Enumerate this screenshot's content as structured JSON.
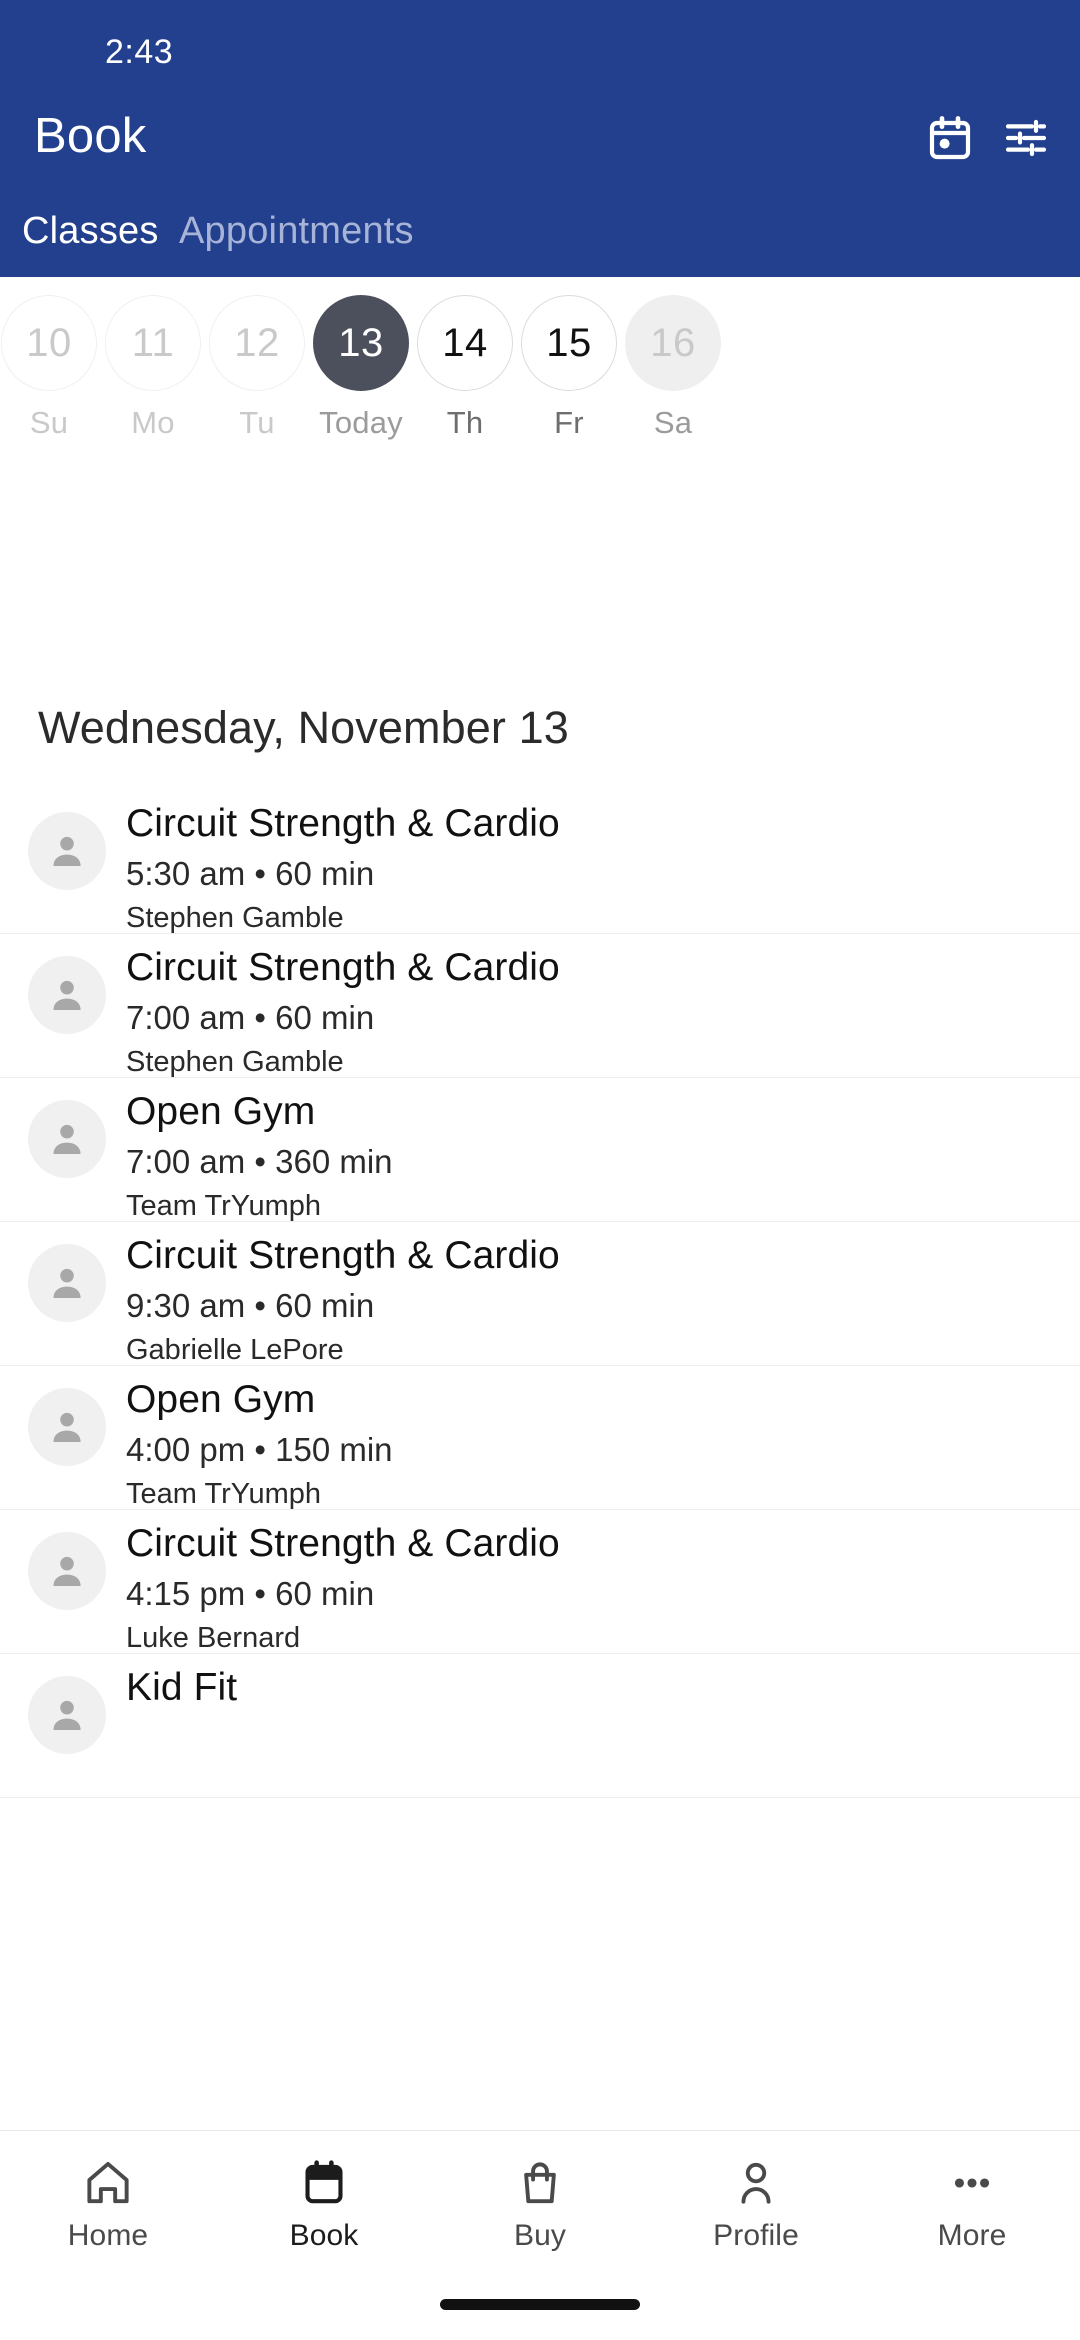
{
  "status_bar": {
    "clock": "2:43"
  },
  "header": {
    "title": "Book",
    "actions": [
      {
        "name": "calendar-picker-icon",
        "label": "Calendar"
      },
      {
        "name": "filter-icon",
        "label": "Filters"
      }
    ],
    "tabs": [
      {
        "label": "Classes",
        "active": true
      },
      {
        "label": "Appointments",
        "active": false
      }
    ],
    "background": "#23408e",
    "active_tab_color": "#ffffff",
    "inactive_tab_color": "#a7b4d8"
  },
  "date_strip": {
    "days": [
      {
        "day": "10",
        "weekday": "Su",
        "state": "past"
      },
      {
        "day": "11",
        "weekday": "Mo",
        "state": "past"
      },
      {
        "day": "12",
        "weekday": "Tu",
        "state": "past"
      },
      {
        "day": "13",
        "weekday": "Today",
        "state": "today"
      },
      {
        "day": "14",
        "weekday": "Th",
        "state": "future"
      },
      {
        "day": "15",
        "weekday": "Fr",
        "state": "future"
      },
      {
        "day": "16",
        "weekday": "Sa",
        "state": "edge"
      }
    ],
    "selected_color": "#4c505c"
  },
  "day_heading": "Wednesday, November 13",
  "classes": [
    {
      "title": "Circuit Strength & Cardio",
      "meta": "5:30 am • 60 min",
      "staff": "Stephen Gamble"
    },
    {
      "title": "Circuit Strength & Cardio",
      "meta": "7:00 am • 60 min",
      "staff": "Stephen Gamble"
    },
    {
      "title": "Open Gym",
      "meta": "7:00 am • 360 min",
      "staff": "Team TrYumph"
    },
    {
      "title": "Circuit Strength & Cardio",
      "meta": "9:30 am • 60 min",
      "staff": "Gabrielle LePore"
    },
    {
      "title": "Open Gym",
      "meta": "4:00 pm • 150 min",
      "staff": "Team TrYumph"
    },
    {
      "title": "Circuit Strength & Cardio",
      "meta": "4:15 pm • 60 min",
      "staff": "Luke Bernard"
    },
    {
      "title": "Kid Fit",
      "meta": "",
      "staff": ""
    }
  ],
  "bottom_nav": {
    "items": [
      {
        "label": "Home",
        "icon": "home-icon",
        "active": false
      },
      {
        "label": "Book",
        "icon": "calendar-icon",
        "active": true
      },
      {
        "label": "Buy",
        "icon": "shopping-bag-icon",
        "active": false
      },
      {
        "label": "Profile",
        "icon": "person-icon",
        "active": false
      },
      {
        "label": "More",
        "icon": "ellipsis-icon",
        "active": false
      }
    ]
  }
}
